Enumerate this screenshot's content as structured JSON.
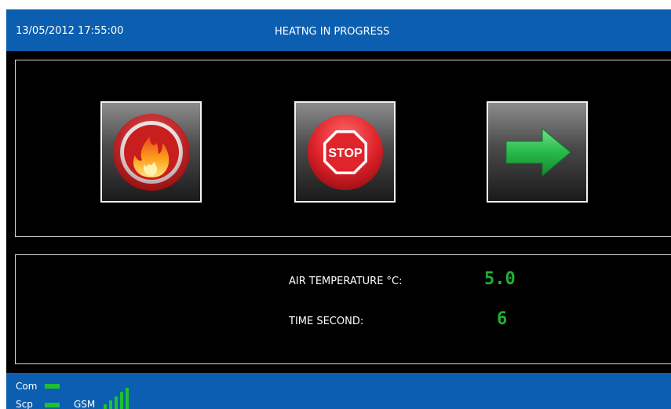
{
  "header": {
    "datetime": "13/05/2012 17:55:00",
    "status_title": "HEATNG IN PROGRESS"
  },
  "buttons": {
    "heat": {
      "icon": "flame-icon"
    },
    "stop": {
      "icon": "stop-sign-icon",
      "label": "STOP"
    },
    "next": {
      "icon": "right-arrow-icon"
    }
  },
  "readings": {
    "air_temperature_label": "AIR TEMPERATURE °C:",
    "air_temperature_value": "5.0",
    "time_label": "TIME SECOND:",
    "time_value": "6"
  },
  "footer": {
    "com_label": "Com",
    "scp_label": "Scp",
    "gsm_label": "GSM",
    "gsm_signal_bars": 5
  },
  "colors": {
    "bar_blue": "#0c5fb0",
    "value_green": "#20b030",
    "indicator_green": "#20c030",
    "stop_red": "#e0242b",
    "arrow_green": "#28b94a"
  }
}
